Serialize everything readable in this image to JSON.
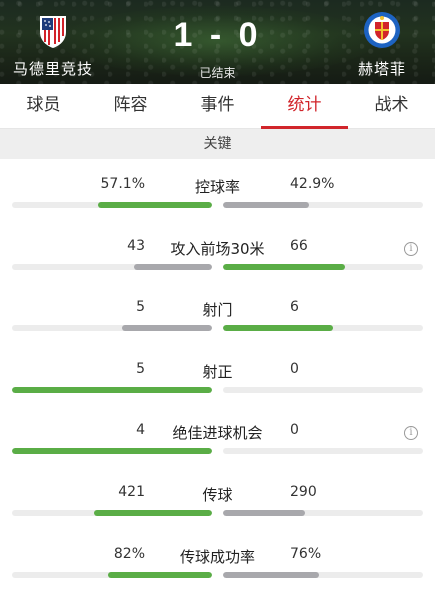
{
  "match": {
    "home_team": "马德里竞技",
    "away_team": "赫塔菲",
    "score": "1 - 0",
    "status": "已结束"
  },
  "tabs": [
    {
      "label": "球员",
      "active": false
    },
    {
      "label": "阵容",
      "active": false
    },
    {
      "label": "事件",
      "active": false
    },
    {
      "label": "统计",
      "active": true
    },
    {
      "label": "战术",
      "active": false
    }
  ],
  "section_title": "关键",
  "colors": {
    "accent": "#d1252b",
    "win_bar": "#5aad46",
    "lose_bar": "#a8a8ac",
    "track": "#ececec"
  },
  "stats": [
    {
      "label": "控球率",
      "home": "57.1%",
      "away": "42.9%",
      "home_share": 0.571,
      "away_share": 0.429,
      "info": false
    },
    {
      "label": "攻入前场30米",
      "home": "43",
      "away": "66",
      "home_share": 0.39,
      "away_share": 0.61,
      "info": true
    },
    {
      "label": "射门",
      "home": "5",
      "away": "6",
      "home_share": 0.45,
      "away_share": 0.55,
      "info": false
    },
    {
      "label": "射正",
      "home": "5",
      "away": "0",
      "home_share": 1.0,
      "away_share": 0.0,
      "info": false
    },
    {
      "label": "绝佳进球机会",
      "home": "4",
      "away": "0",
      "home_share": 1.0,
      "away_share": 0.0,
      "info": true
    },
    {
      "label": "传球",
      "home": "421",
      "away": "290",
      "home_share": 0.59,
      "away_share": 0.41,
      "info": false
    },
    {
      "label": "传球成功率",
      "home": "82%",
      "away": "76%",
      "home_share": 0.52,
      "away_share": 0.48,
      "info": false
    }
  ]
}
